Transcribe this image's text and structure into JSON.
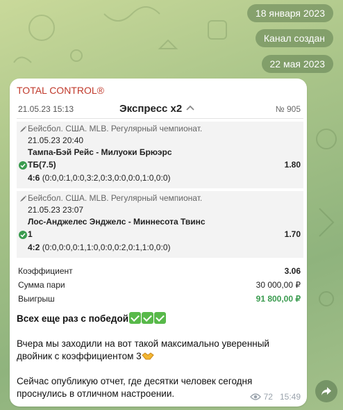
{
  "pills": {
    "date1": "18 января 2023",
    "created": "Канал создан",
    "date2": "22 мая 2023"
  },
  "message": {
    "channel_name": "TOTAL CONTROL®",
    "bet": {
      "date": "21.05.23 15:13",
      "title": "Экспресс x2",
      "number": "№ 905"
    },
    "events": [
      {
        "league": "Бейсбол. США. MLB. Регулярный чемпионат.",
        "time": "21.05.23 20:40",
        "teams": "Тампа-Бэй Рейс - Милуоки Брюэрс",
        "pick": "ТБ(7.5)",
        "odd": "1.80",
        "score": "4:6",
        "score_detail": "(0:0,0:1,0:0,3:2,0:3,0:0,0:0,1:0,0:0)"
      },
      {
        "league": "Бейсбол. США. MLB. Регулярный чемпионат.",
        "time": "21.05.23 23:07",
        "teams": "Лос-Анджелес Энджелс - Миннесота Твинс",
        "pick": "1",
        "odd": "1.70",
        "score": "4:2",
        "score_detail": "(0:0,0:0,0:1,1:0,0:0,0:2,0:1,1:0,0:0)"
      }
    ],
    "summary": {
      "coef_label": "Коэффициент",
      "coef_value": "3.06",
      "stake_label": "Сумма пари",
      "stake_value": "30 000,00 ₽",
      "win_label": "Выигрыш",
      "win_value": "91 800,00 ₽"
    },
    "text": {
      "line1": "Всех еще раз с победой",
      "line2": "Вчера мы заходили на вот такой максимально уверенный двойник с коэффициентом 3",
      "line3": "Сейчас опубликую отчет, где десятки человек сегодня проснулись в отличном настроении."
    },
    "views": "72",
    "time": "15:49"
  },
  "colors": {
    "channel": "#c0392b",
    "win": "#3a9b4f",
    "check": "#58b94a"
  }
}
